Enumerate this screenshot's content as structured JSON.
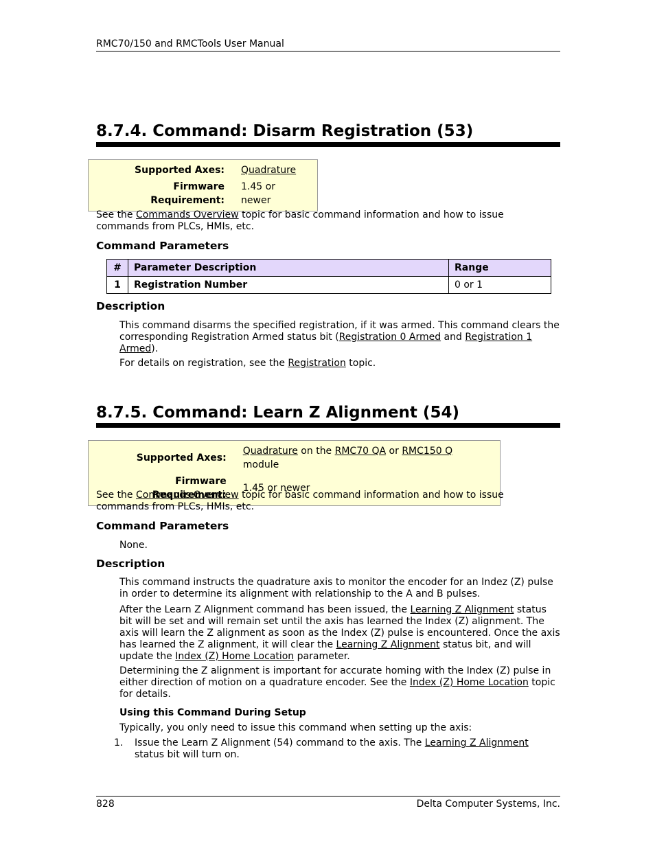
{
  "header": {
    "manual_title": "RMC70/150 and RMCTools User Manual"
  },
  "footer": {
    "page_number": "828",
    "company": "Delta Computer Systems, Inc."
  },
  "section1": {
    "title": "8.7.4. Command: Disarm Registration (53)",
    "info": {
      "supported_axes_label": "Supported Axes:",
      "supported_axes_link": "Quadrature",
      "firmware_label": "Firmware Requirement:",
      "firmware_value": "1.45 or newer"
    },
    "intro": {
      "pre": "See the ",
      "link": "Commands Overview",
      "post": " topic for basic command information and how to issue commands from PLCs, HMIs, etc."
    },
    "params_heading": "Command Parameters",
    "params_table": {
      "headers": [
        "#",
        "Parameter Description",
        "Range"
      ],
      "rows": [
        {
          "num": "1",
          "description": "Registration Number",
          "range": "0 or 1"
        }
      ]
    },
    "description_heading": "Description",
    "desc_p1": {
      "pre": "This command disarms the specified registration, if it was armed. This command clears the corresponding Registration Armed status bit (",
      "link1": "Registration 0 Armed",
      "mid": " and ",
      "link2": "Registration 1 Armed",
      "post": ")."
    },
    "desc_p2": {
      "pre": "For details on registration, see the ",
      "link": "Registration",
      "post": " topic."
    }
  },
  "section2": {
    "title": "8.7.5. Command: Learn Z Alignment (54)",
    "info": {
      "supported_axes_label": "Supported Axes:",
      "axes_link1": "Quadrature",
      "axes_text1": " on the ",
      "axes_link2": "RMC70 QA",
      "axes_text2": " or ",
      "axes_link3": "RMC150 Q",
      "axes_text3": " module",
      "firmware_label": "Firmware Requirement:",
      "firmware_value": "1.45 or newer"
    },
    "intro": {
      "pre": "See the ",
      "link": "Commands Overview",
      "post": " topic for basic command information and how to issue commands from PLCs, HMIs, etc."
    },
    "params_heading": "Command Parameters",
    "params_none": "None.",
    "description_heading": "Description",
    "desc_p1": "This command instructs the quadrature axis to monitor the encoder for an Indez (Z) pulse in order to determine its alignment with relationship to the A and B pulses.",
    "desc_p2": {
      "t1": "After the Learn Z Alignment command has been issued, the ",
      "link1": "Learning Z Alignment",
      "t2": " status bit will be set and will remain set until the axis has learned the Index (Z) alignment. The axis will learn the Z alignment as soon as the Index (Z) pulse is encountered. Once the axis has learned the Z alignment, it will clear the ",
      "link2": "Learning Z Alignment",
      "t3": " status bit, and will update the ",
      "link3": "Index (Z) Home Location",
      "t4": " parameter."
    },
    "desc_p3": {
      "t1": "Determining the Z alignment is important for accurate homing with the Index (Z) pulse in either direction of motion on a quadrature encoder. See the ",
      "link": "Index (Z) Home Location",
      "t2": " topic for details."
    },
    "setup_heading": "Using this Command During Setup",
    "setup_intro": "Typically, you only need to issue this command when setting up the axis:",
    "steps": [
      {
        "marker": "1.",
        "pre": "Issue the Learn Z Alignment (54) command to the axis. The ",
        "link": "Learning Z Alignment",
        "post": " status bit will turn on."
      }
    ]
  }
}
